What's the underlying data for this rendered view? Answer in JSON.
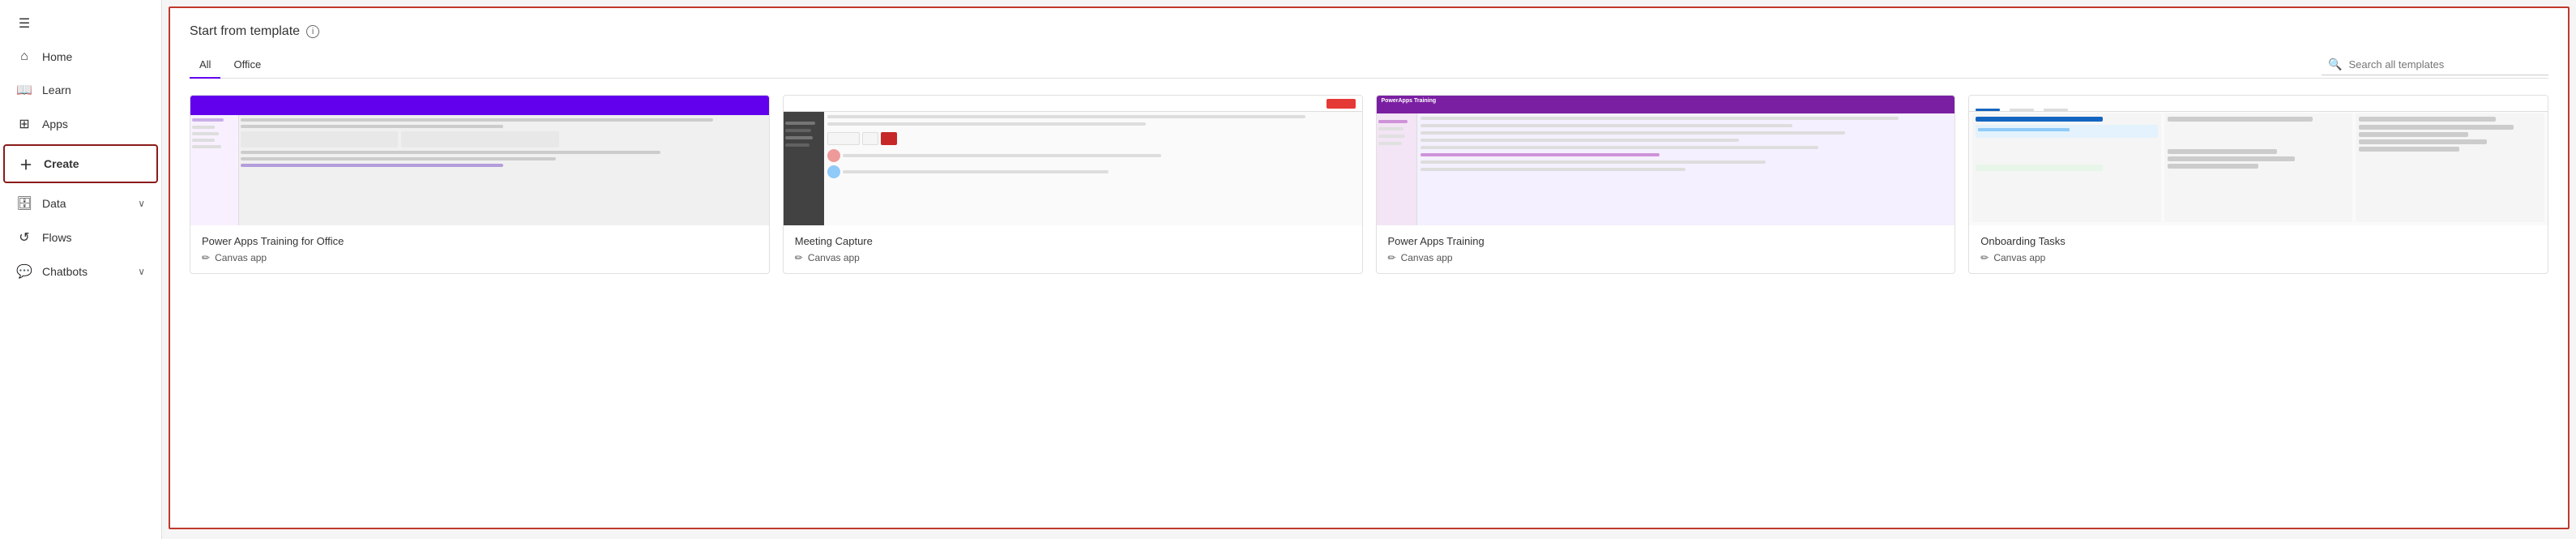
{
  "sidebar": {
    "hamburger_label": "≡",
    "items": [
      {
        "id": "home",
        "label": "Home",
        "icon": "⌂",
        "has_chevron": false
      },
      {
        "id": "learn",
        "label": "Learn",
        "icon": "📖",
        "has_chevron": false
      },
      {
        "id": "apps",
        "label": "Apps",
        "icon": "⊞",
        "has_chevron": false
      },
      {
        "id": "create",
        "label": "Create",
        "icon": "+",
        "has_chevron": false
      },
      {
        "id": "data",
        "label": "Data",
        "icon": "🗄",
        "has_chevron": true
      },
      {
        "id": "flows",
        "label": "Flows",
        "icon": "⟲",
        "has_chevron": false
      },
      {
        "id": "chatbots",
        "label": "Chatbots",
        "icon": "💬",
        "has_chevron": true
      }
    ]
  },
  "main": {
    "section_title": "Start from template",
    "info_icon_label": "ⓘ",
    "tabs": [
      {
        "id": "all",
        "label": "All",
        "active": true
      },
      {
        "id": "office",
        "label": "Office",
        "active": false
      }
    ],
    "search_placeholder": "Search all templates",
    "cards": [
      {
        "id": "powerapps-training-office",
        "name": "Power Apps Training for Office",
        "type": "Canvas app"
      },
      {
        "id": "meeting-capture",
        "name": "Meeting Capture",
        "type": "Canvas app"
      },
      {
        "id": "powerapps-training",
        "name": "Power Apps Training",
        "type": "Canvas app"
      },
      {
        "id": "onboarding-tasks",
        "name": "Onboarding Tasks",
        "type": "Canvas app"
      }
    ]
  }
}
